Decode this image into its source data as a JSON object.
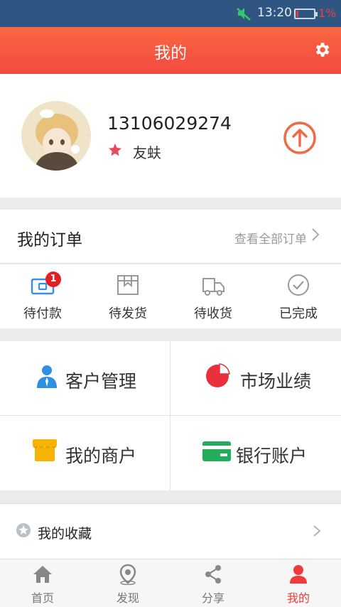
{
  "status_bar": {
    "time": "13:20",
    "battery_pct": "1%"
  },
  "header": {
    "title": "我的"
  },
  "profile": {
    "phone": "13106029274",
    "level": "友蚨"
  },
  "orders": {
    "title": "我的订单",
    "view_all": "查看全部订单",
    "items": [
      {
        "label": "待付款",
        "badge": "1"
      },
      {
        "label": "待发货"
      },
      {
        "label": "待收货"
      },
      {
        "label": "已完成"
      }
    ]
  },
  "features": [
    {
      "label": "客户管理",
      "icon": "person-icon"
    },
    {
      "label": "市场业绩",
      "icon": "pie-chart-icon"
    },
    {
      "label": "我的商户",
      "icon": "store-icon"
    },
    {
      "label": "银行账户",
      "icon": "bank-card-icon"
    }
  ],
  "favorites": {
    "label": "我的收藏"
  },
  "tabs": [
    {
      "label": "首页",
      "icon": "home-icon"
    },
    {
      "label": "发现",
      "icon": "location-icon"
    },
    {
      "label": "分享",
      "icon": "share-icon"
    },
    {
      "label": "我的",
      "icon": "user-icon",
      "active": true
    }
  ],
  "colors": {
    "accent": "#f24a40",
    "statusbar": "#2f5583"
  }
}
